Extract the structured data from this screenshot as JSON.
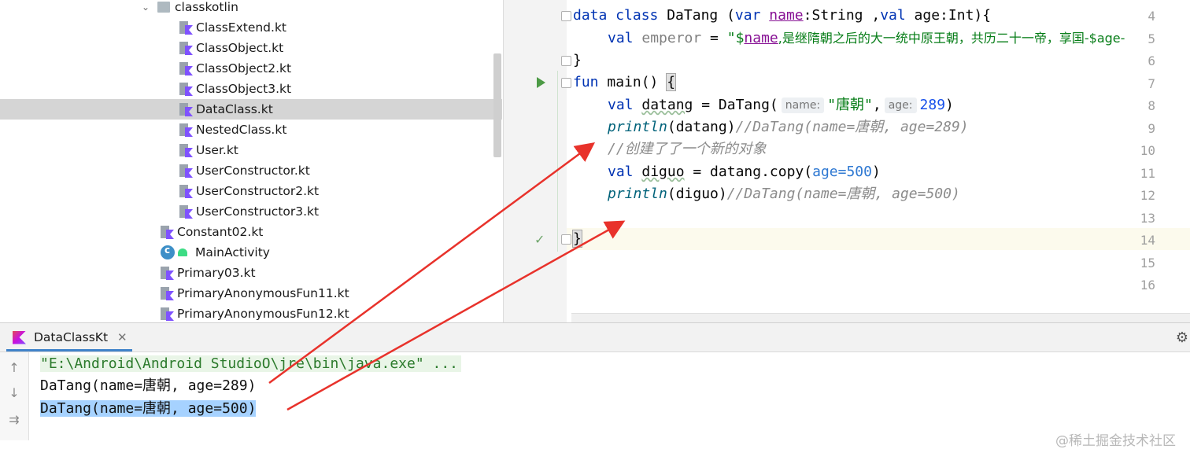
{
  "project_tree": {
    "folder": "classkotlin",
    "items": [
      {
        "label": "ClassExtend.kt"
      },
      {
        "label": "ClassObject.kt"
      },
      {
        "label": "ClassObject2.kt"
      },
      {
        "label": "ClassObject3.kt"
      },
      {
        "label": "DataClass.kt"
      },
      {
        "label": "NestedClass.kt"
      },
      {
        "label": "User.kt"
      },
      {
        "label": "UserConstructor.kt"
      },
      {
        "label": "UserConstructor2.kt"
      },
      {
        "label": "UserConstructor3.kt"
      }
    ],
    "outer_items": [
      {
        "label": "Constant02.kt"
      },
      {
        "label": "MainActivity"
      },
      {
        "label": "Primary03.kt"
      },
      {
        "label": "PrimaryAnonymousFun11.kt"
      },
      {
        "label": "PrimaryAnonymousFun12.kt"
      }
    ]
  },
  "editor": {
    "line_numbers": [
      "4",
      "5",
      "6",
      "7",
      "8",
      "9",
      "10",
      "11",
      "12",
      "13",
      "14",
      "15",
      "16"
    ],
    "line4": {
      "kw1": "data class ",
      "cls": "DaTang (",
      "kw2": "var ",
      "param": "name",
      "rest1": ":String ,",
      "kw3": "val ",
      "rest2": "age:Int){"
    },
    "line5": {
      "kw": "val ",
      "prop": "emperor",
      "eq": " = ",
      "str1": "\"$",
      "strvar": "name",
      "str2": ",是继隋朝之后的大一统中原王朝，共历二十一帝，享国-$age-"
    },
    "line6": "}",
    "line7": {
      "kw": "fun ",
      "name": "main() ",
      "brace": "{"
    },
    "line8": {
      "kw": "val ",
      "var": "datang",
      "pre": " = DaTang(",
      "hint1": "name:",
      "str": "\"唐朝\"",
      "sep": ",",
      "hint2": "age:",
      "num": "289",
      "post": ")"
    },
    "line9": {
      "fn": "println",
      "args": "(datang)",
      "cmt": "//DaTang(name=唐朝, age=289)"
    },
    "line10": {
      "cmt": "//创建了了一个新的对象"
    },
    "line11": {
      "kw": "val ",
      "var": "diguo",
      "pre": " = datang.copy(",
      "named": "age=500",
      "post": ")"
    },
    "line12": {
      "fn": "println",
      "args": "(diguo)",
      "cmt": "//DaTang(name=唐朝, age=500)"
    },
    "line14": "}"
  },
  "run_panel": {
    "tab_label": "DataClassKt",
    "command": "\"E:\\Android\\Android StudioO\\jre\\bin\\java.exe\" ...",
    "output1": "DaTang(name=唐朝, age=289)",
    "output2": "DaTang(name=唐朝, age=500)",
    "watermark": "@稀土掘金技术社区"
  },
  "colors": {
    "arrow": "#e8322b",
    "selection": "#a6d2ff",
    "keyword": "#0033b3",
    "string": "#067d17"
  }
}
